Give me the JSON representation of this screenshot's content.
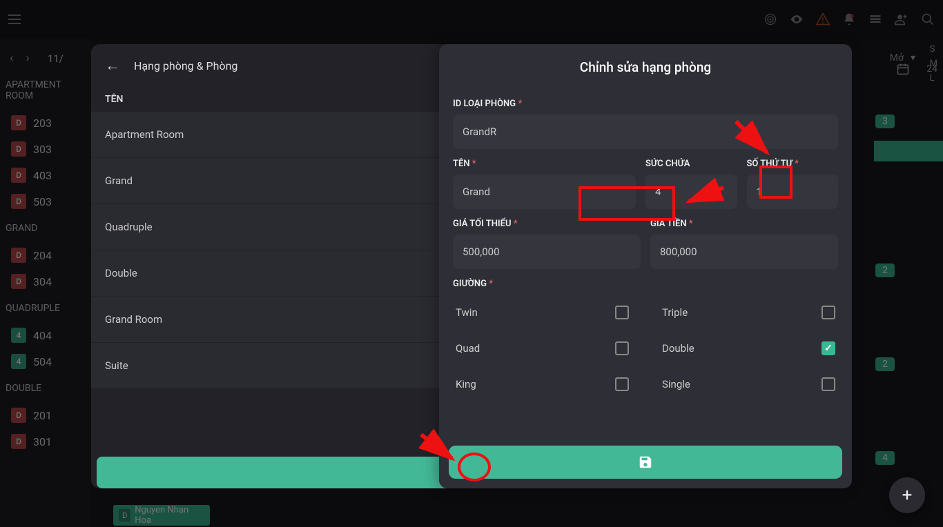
{
  "header": {
    "date_partial_left": "11/",
    "date_partial_right": "24"
  },
  "sidebar_dropdown": {
    "label": "Mở"
  },
  "side_letters": [
    "S",
    "M",
    "L"
  ],
  "room_groups": [
    {
      "name": "APARTMENT ROOM",
      "rooms": [
        {
          "badge": "D",
          "num": "203",
          "style": "d"
        },
        {
          "badge": "D",
          "num": "303",
          "style": "d"
        },
        {
          "badge": "D",
          "num": "403",
          "style": "d"
        },
        {
          "badge": "D",
          "num": "503",
          "style": "d"
        }
      ]
    },
    {
      "name": "GRAND",
      "rooms": [
        {
          "badge": "D",
          "num": "204",
          "style": "d"
        },
        {
          "badge": "D",
          "num": "304",
          "style": "d"
        }
      ]
    },
    {
      "name": "QUADRUPLE",
      "rooms": [
        {
          "badge": "4",
          "num": "404",
          "style": "4"
        },
        {
          "badge": "4",
          "num": "504",
          "style": "4"
        }
      ]
    },
    {
      "name": "DOUBLE",
      "rooms": [
        {
          "badge": "D",
          "num": "201",
          "style": "d"
        },
        {
          "badge": "D",
          "num": "301",
          "style": "d"
        }
      ]
    }
  ],
  "count_badges": {
    "apt": "3",
    "grand": "2",
    "quad": "2",
    "double": "4"
  },
  "panel": {
    "title": "Hạng phòng & Phòng",
    "col_label": "TÊN",
    "types": [
      {
        "name": "Apartment Room"
      },
      {
        "name": "Grand"
      },
      {
        "name": "Quadruple"
      },
      {
        "name": "Double"
      },
      {
        "name": "Grand Room"
      },
      {
        "name": "Suite"
      }
    ]
  },
  "modal": {
    "title": "Chỉnh sửa hạng phòng",
    "labels": {
      "id": "ID LOẠI PHÒNG",
      "name": "TÊN",
      "capacity": "SỨC CHỨA",
      "order": "SỐ THỨ TỰ",
      "min_price": "GIÁ TỐI THIỂU",
      "price": "GIÁ TIỀN",
      "bed": "GIƯỜNG"
    },
    "values": {
      "id": "GrandR",
      "name": "Grand",
      "capacity": "4",
      "order": "1",
      "min_price": "500,000",
      "price": "800,000"
    },
    "beds": [
      {
        "name": "Twin",
        "checked": false
      },
      {
        "name": "Triple",
        "checked": false
      },
      {
        "name": "Quad",
        "checked": false
      },
      {
        "name": "Double",
        "checked": true
      },
      {
        "name": "King",
        "checked": false
      },
      {
        "name": "Single",
        "checked": false
      }
    ]
  },
  "booking": {
    "name": "Nguyen Nhan Hoa",
    "badge": "D"
  }
}
